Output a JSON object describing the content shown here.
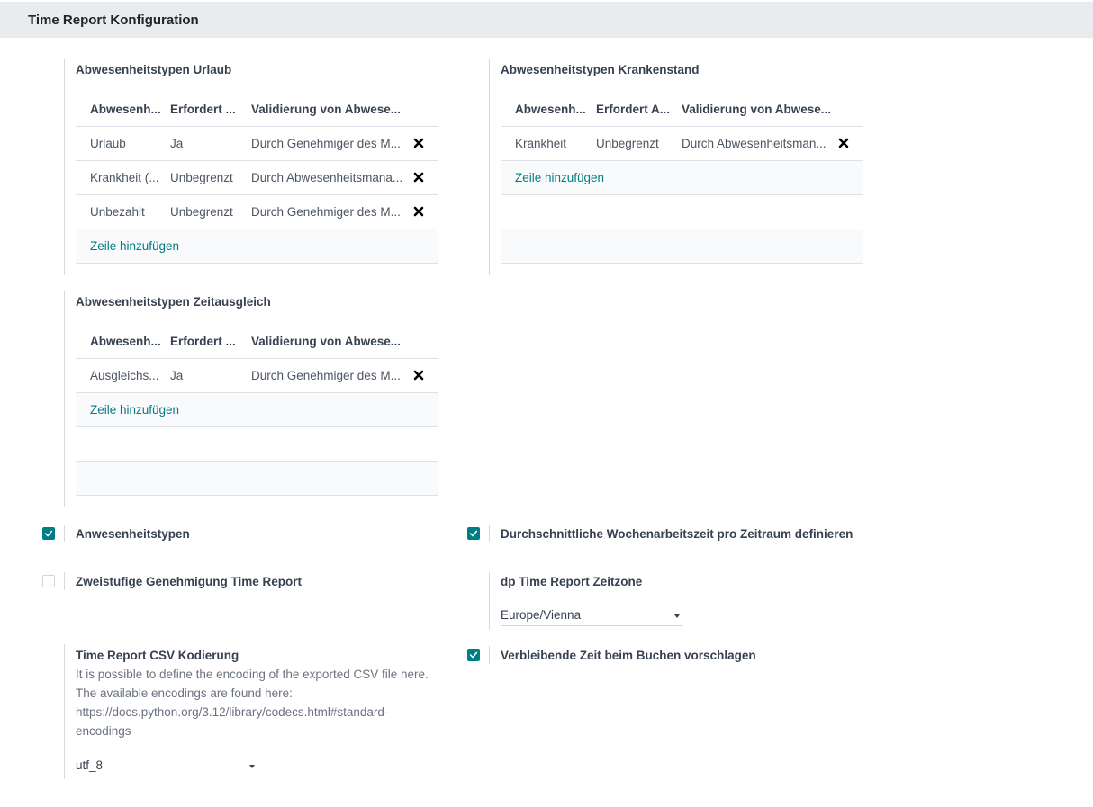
{
  "header": {
    "title": "Time Report Konfiguration"
  },
  "urlaub": {
    "title": "Abwesenheitstypen Urlaub",
    "columns": [
      "Abwesenh...",
      "Erfordert ...",
      "Validierung von Abwese..."
    ],
    "rows": [
      [
        "Urlaub",
        "Ja",
        "Durch Genehmiger des M..."
      ],
      [
        "Krankheit (...",
        "Unbegrenzt",
        "Durch Abwesenheitsmana..."
      ],
      [
        "Unbezahlt",
        "Unbegrenzt",
        "Durch Genehmiger des M..."
      ]
    ],
    "add_line": "Zeile hinzufügen"
  },
  "krankenstand": {
    "title": "Abwesenheitstypen Krankenstand",
    "columns": [
      "Abwesenh...",
      "Erfordert A...",
      "Validierung von Abwese..."
    ],
    "rows": [
      [
        "Krankheit",
        "Unbegrenzt",
        "Durch Abwesenheitsman..."
      ]
    ],
    "add_line": "Zeile hinzufügen"
  },
  "zeitausgleich": {
    "title": "Abwesenheitstypen Zeitausgleich",
    "columns": [
      "Abwesenh...",
      "Erfordert ...",
      "Validierung von Abwese..."
    ],
    "rows": [
      [
        "Ausgleichs...",
        "Ja",
        "Durch Genehmiger des M..."
      ]
    ],
    "add_line": "Zeile hinzufügen"
  },
  "settings": {
    "anwesenheitstypen": {
      "label": "Anwesenheitstypen",
      "checked": true
    },
    "wochenarbeitszeit": {
      "label": "Durchschnittliche Wochenarbeitszeit pro Zeitraum definieren",
      "checked": true
    },
    "zweistufig": {
      "label": "Zweistufige Genehmigung Time Report",
      "checked": false
    },
    "zeitzone": {
      "label": "dp Time Report Zeitzone",
      "value": "Europe/Vienna"
    },
    "csv": {
      "label": "Time Report CSV Kodierung",
      "help": "It is possible to define the encoding of the exported CSV file here. The available encodings are found here: https://docs.python.org/3.12/library/codecs.html#standard-encodings",
      "value": "utf_8"
    },
    "verbleibend": {
      "label": "Verbleibende Zeit beim Buchen vorschlagen",
      "checked": true
    }
  },
  "colors": {
    "accent": "#017e84",
    "header_bg": "#e9ecef"
  }
}
